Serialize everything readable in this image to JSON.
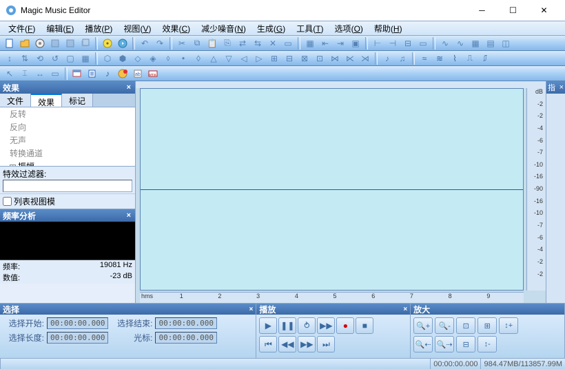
{
  "window": {
    "title": "Magic Music Editor"
  },
  "menu": {
    "items": [
      {
        "label": "文件",
        "accel": "F"
      },
      {
        "label": "编辑",
        "accel": "E"
      },
      {
        "label": "播放",
        "accel": "P"
      },
      {
        "label": "视图",
        "accel": "V"
      },
      {
        "label": "效果",
        "accel": "C"
      },
      {
        "label": "减少噪音",
        "accel": "N"
      },
      {
        "label": "生成",
        "accel": "G"
      },
      {
        "label": "工具",
        "accel": "T"
      },
      {
        "label": "选项",
        "accel": "O"
      },
      {
        "label": "帮助",
        "accel": "H"
      }
    ]
  },
  "effects_panel": {
    "title": "效果",
    "tabs": {
      "file": "文件",
      "effects": "效果",
      "marks": "标记"
    },
    "tree": [
      {
        "label": "反转",
        "enabled": false
      },
      {
        "label": "反向",
        "enabled": false
      },
      {
        "label": "无声",
        "enabled": false
      },
      {
        "label": "转换通道",
        "enabled": false
      },
      {
        "label": "振幅",
        "enabled": true,
        "expandable": true
      }
    ],
    "filter_label": "特效过滤器:",
    "list_view_label": "列表视图模"
  },
  "freq_panel": {
    "title": "频率分析",
    "freq_label": "频率:",
    "freq_value": "19081 Hz",
    "val_label": "数值:",
    "val_value": "-23 dB"
  },
  "waveform": {
    "db_unit": "dB",
    "db_ticks": [
      "-2",
      "-2",
      "-4",
      "-6",
      "-7",
      "-10",
      "-16",
      "-90",
      "-16",
      "-10",
      "-7",
      "-6",
      "-4",
      "-2",
      "-2"
    ],
    "time_unit": "hms",
    "time_ticks": [
      "1",
      "2",
      "3",
      "4",
      "5",
      "6",
      "7",
      "8",
      "9"
    ]
  },
  "right_sliver": {
    "title": "指"
  },
  "selection_panel": {
    "title": "选择",
    "start_label": "选择开始:",
    "end_label": "选择结束:",
    "length_label": "选择长度:",
    "cursor_label": "光标:",
    "time_zero": "00:00:00.000"
  },
  "playback_panel": {
    "title": "播放"
  },
  "zoom_panel": {
    "title": "放大"
  },
  "status": {
    "time": "00:00:00.000",
    "memory": "984.47MB/113857.99M"
  }
}
